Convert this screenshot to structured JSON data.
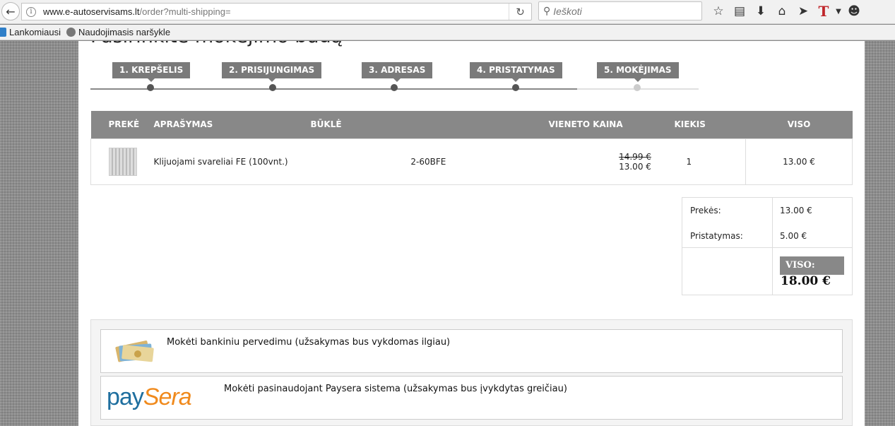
{
  "browser": {
    "url_host": "www.e-autoservisams.lt",
    "url_path": "/order?multi-shipping=",
    "search_placeholder": "Ieškoti",
    "bookmarks": [
      "Lankomiausi",
      "Naudojimasis naršykle"
    ]
  },
  "page": {
    "heading": "Pasirinkite mokėjimo būdą"
  },
  "steps": [
    {
      "label": "1. KREPŠELIS",
      "done": true
    },
    {
      "label": "2. PRISIJUNGIMAS",
      "done": true
    },
    {
      "label": "3. ADRESAS",
      "done": true
    },
    {
      "label": "4. PRISTATYMAS",
      "done": true
    },
    {
      "label": "5. MOKĖJIMAS",
      "done": false
    }
  ],
  "cart": {
    "headers": {
      "product": "PREKĖ",
      "description": "APRAŠYMAS",
      "status": "BŪKLĖ",
      "unit_price": "VIENETO KAINA",
      "quantity": "KIEKIS",
      "total": "VISO"
    },
    "rows": [
      {
        "description": "Klijuojami svareliai FE (100vnt.)",
        "code": "2-60BFE",
        "old_price": "14.99 €",
        "price": "13.00 €",
        "quantity": "1",
        "total": "13.00 €"
      }
    ]
  },
  "totals": {
    "products_label": "Prekės:",
    "products_value": "13.00 €",
    "shipping_label": "Pristatymas:",
    "shipping_value": "5.00 €",
    "grand_label": "VISO:",
    "grand_value": "18.00 €"
  },
  "payment": {
    "options": [
      {
        "text": "Mokėti bankiniu pervedimu (užsakymas bus vykdomas ilgiau)",
        "icon": "money-icon"
      },
      {
        "text": "Mokėti pasinaudojant Paysera sistema (užsakymas bus įvykdytas greičiau)",
        "logo_a": "pay",
        "logo_b": "Sera"
      }
    ]
  }
}
